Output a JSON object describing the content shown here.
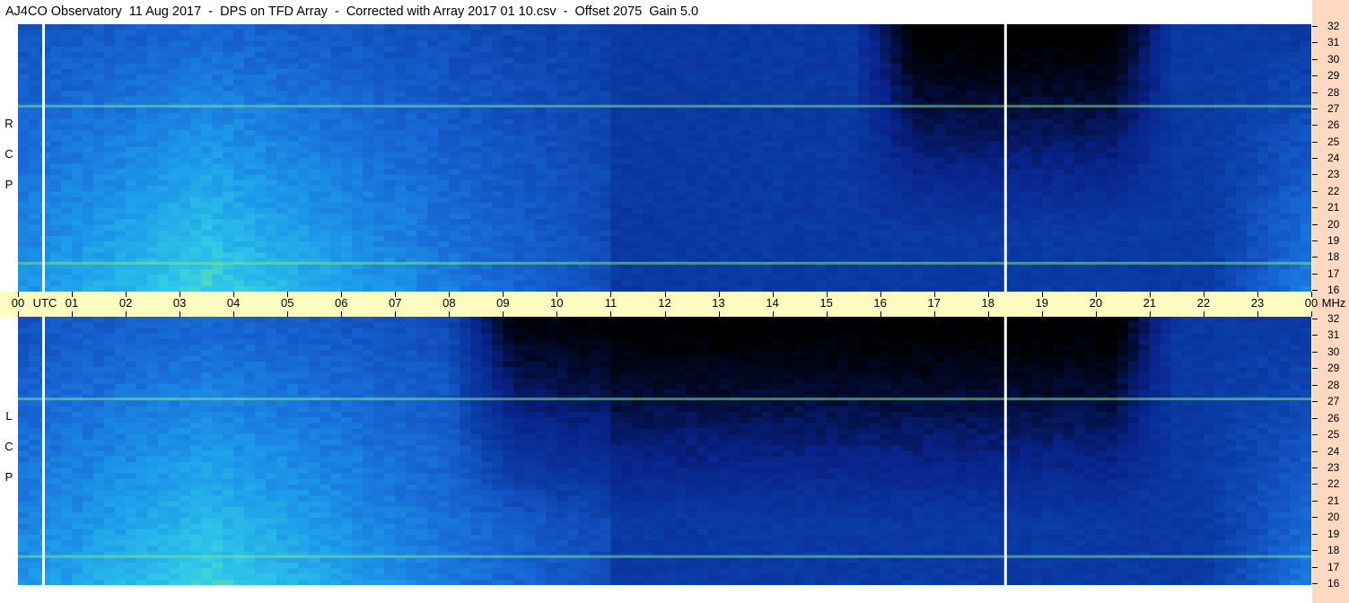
{
  "title": "AJ4CO Observatory  11 Aug 2017  -  DPS on TFD Array  -  Corrected with Array 2017 01 10.csv  -  Offset 2075  Gain 5.0",
  "chart_data": [
    {
      "type": "heatmap",
      "name": "RCP",
      "polarization_label": [
        "R",
        "C",
        "P"
      ],
      "x_axis": {
        "unit_label": "UTC",
        "range": [
          0,
          24
        ],
        "ticks": [
          "00",
          "01",
          "02",
          "03",
          "04",
          "05",
          "06",
          "07",
          "08",
          "09",
          "10",
          "11",
          "12",
          "13",
          "14",
          "15",
          "16",
          "17",
          "18",
          "19",
          "20",
          "21",
          "22",
          "23",
          "00"
        ]
      },
      "y_axis": {
        "unit_label": "MHz",
        "range": [
          16,
          32
        ],
        "ticks": [
          "16",
          "17",
          "18",
          "19",
          "20",
          "21",
          "22",
          "23",
          "24",
          "25",
          "26",
          "27",
          "28",
          "29",
          "30",
          "31",
          "32"
        ]
      },
      "features": {
        "day_enhancement_hours": [
          0,
          11
        ],
        "night_minimum_hours": [
          15.5,
          21.5
        ],
        "dark_column_hours": [
          18.3,
          18.35
        ],
        "interference_bands_mhz": [
          17.7,
          27.1
        ]
      }
    },
    {
      "type": "heatmap",
      "name": "LCP",
      "polarization_label": [
        "L",
        "C",
        "P"
      ],
      "x_axis": {
        "unit_label": "UTC",
        "range": [
          0,
          24
        ],
        "ticks": [
          "00",
          "01",
          "02",
          "03",
          "04",
          "05",
          "06",
          "07",
          "08",
          "09",
          "10",
          "11",
          "12",
          "13",
          "14",
          "15",
          "16",
          "17",
          "18",
          "19",
          "20",
          "21",
          "22",
          "23",
          "00"
        ]
      },
      "y_axis": {
        "unit_label": "MHz",
        "range": [
          16,
          32
        ],
        "ticks": [
          "16",
          "17",
          "18",
          "19",
          "20",
          "21",
          "22",
          "23",
          "24",
          "25",
          "26",
          "27",
          "28",
          "29",
          "30",
          "31",
          "32"
        ]
      },
      "features": {
        "day_enhancement_hours": [
          0,
          11
        ],
        "night_minimum_hours": [
          8,
          21.5
        ],
        "dark_column_hours": [
          18.3,
          18.35
        ],
        "interference_bands_mhz": [
          17.7,
          27.1
        ]
      }
    }
  ],
  "colors": {
    "background": "#ffffff",
    "time_axis_bg": "#fdfbc0",
    "freq_axis_bg": "#fcd9c0",
    "low_intensity": "#000000",
    "mid_intensity": "#0b3ca6",
    "high_intensity": "#7fe68a"
  }
}
